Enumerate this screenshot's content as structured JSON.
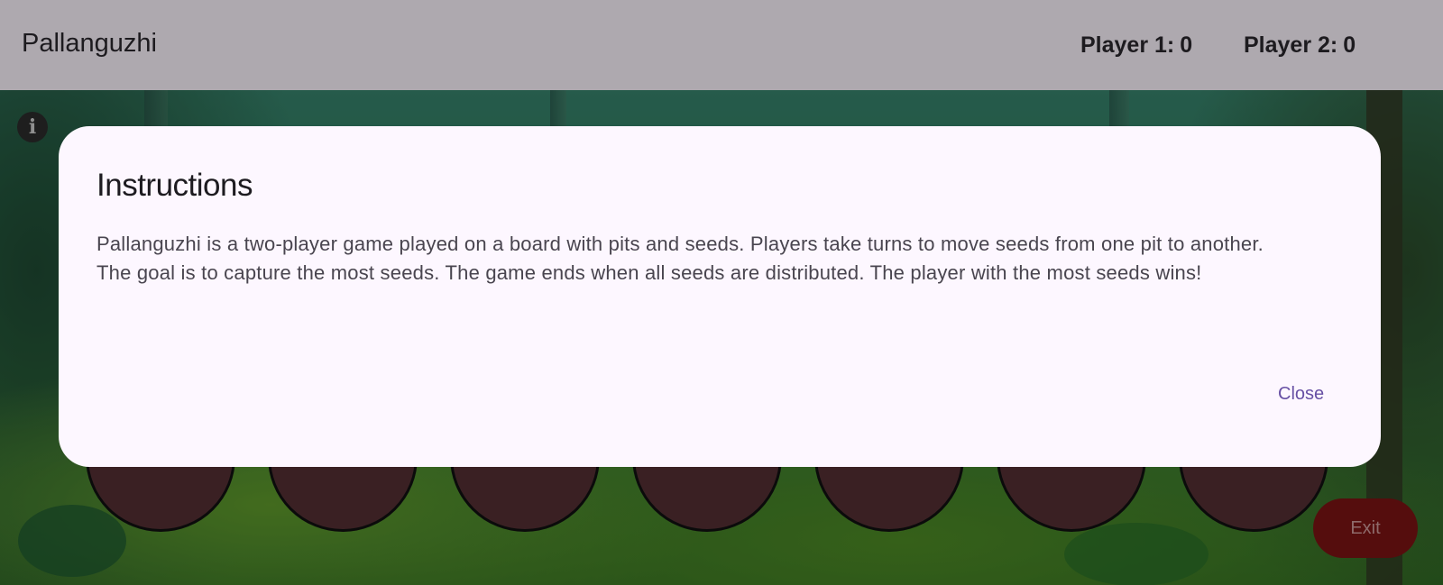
{
  "app": {
    "title": "Pallanguzhi"
  },
  "scores": {
    "player1_label": "Player 1:",
    "player1_value": "0",
    "player2_label": "Player 2:",
    "player2_value": "0"
  },
  "info_icon": {
    "icon": "info-icon",
    "glyph": "i"
  },
  "dialog": {
    "title": "Instructions",
    "body": "Pallanguzhi is a two-player game played on a board with pits and seeds. Players take turns to move seeds from one pit to another. The goal is to capture the most seeds. The game ends when all seeds are distributed. The player with the most seeds wins!",
    "close_label": "Close"
  },
  "board": {
    "visible_pits": 7,
    "pit_color": "#532f33"
  },
  "exit_button": {
    "label": "Exit",
    "color": "#7a1313"
  },
  "colors": {
    "appbar": "#aea9af",
    "dialog_bg": "#fdf7ff",
    "accent": "#6750a4"
  }
}
